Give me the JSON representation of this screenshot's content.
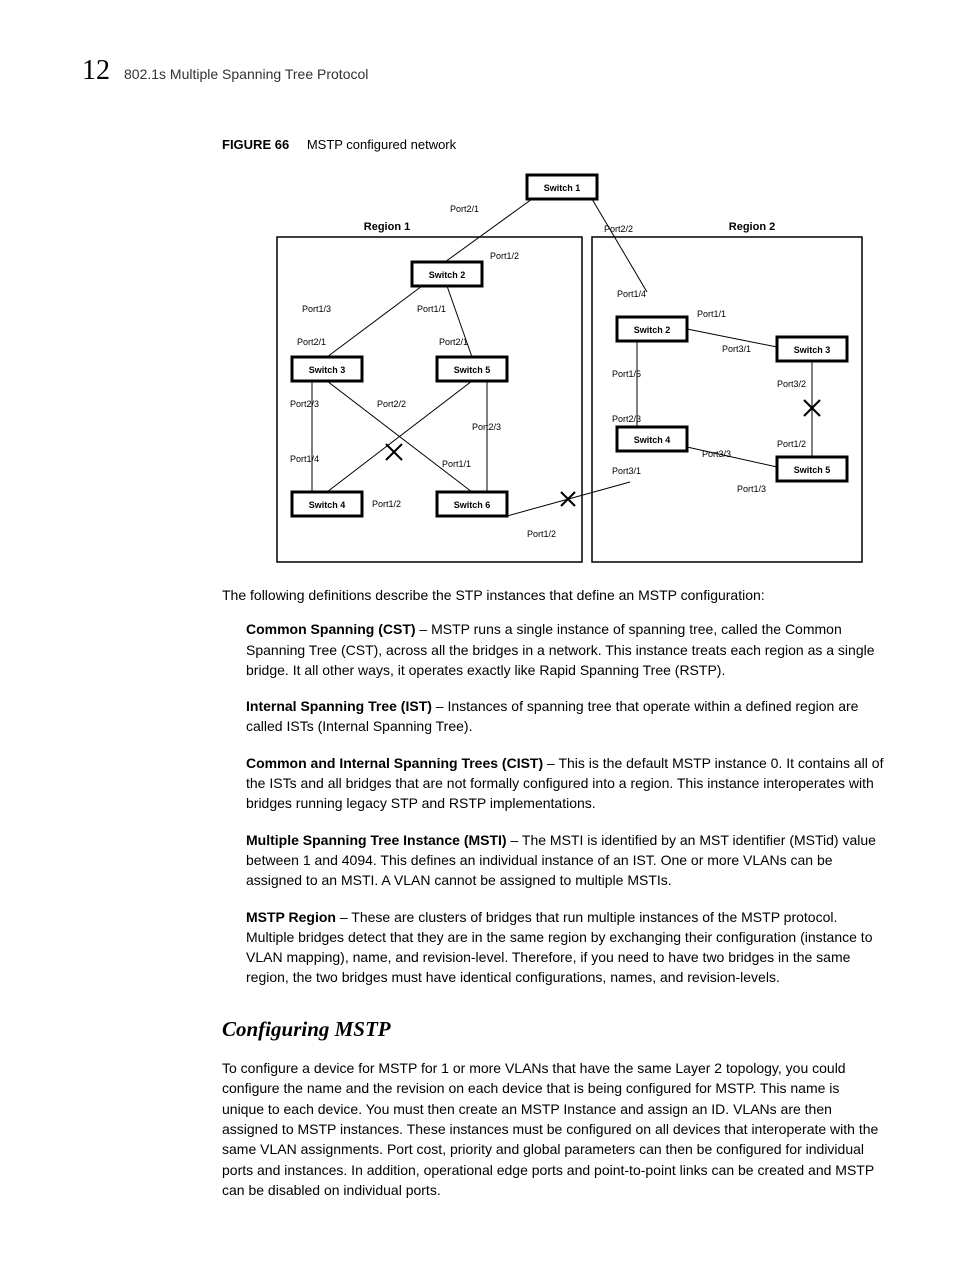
{
  "header": {
    "chapter_number": "12",
    "running_title": "802.1s Multiple Spanning Tree Protocol"
  },
  "figure": {
    "label": "FIGURE 66",
    "caption": "MSTP configured network",
    "diagram": {
      "regions": {
        "r1": "Region 1",
        "r2": "Region 2"
      },
      "switches": {
        "top_s1": "Switch 1",
        "r1_s2": "Switch 2",
        "r1_s3": "Switch 3",
        "r1_s4": "Switch 4",
        "r1_s5": "Switch 5",
        "r1_s6": "Switch 6",
        "r2_s2": "Switch 2",
        "r2_s3": "Switch 3",
        "r2_s4": "Switch 4",
        "r2_s5": "Switch 5"
      },
      "ports": {
        "p21": "Port2/1",
        "p22": "Port2/2",
        "p23": "Port2/3",
        "p11": "Port1/1",
        "p12": "Port1/2",
        "p13": "Port1/3",
        "p14": "Port1/4",
        "p15": "Port1/5",
        "p31": "Port3/1",
        "p32": "Port3/2",
        "p33": "Port3/3"
      }
    }
  },
  "intro": "The following definitions describe the STP instances that define an MSTP configuration:",
  "defs": [
    {
      "term": "Common Spanning (CST)",
      "text": " – MSTP runs a single instance of spanning tree, called the Common Spanning Tree (CST), across all the bridges in a network. This instance treats each region as a single bridge. It all other ways, it operates exactly like Rapid Spanning Tree (RSTP)."
    },
    {
      "term": "Internal Spanning Tree (IST)",
      "text": " – Instances of spanning tree that operate within a defined region are called ISTs (Internal Spanning Tree)."
    },
    {
      "term": "Common and Internal Spanning Trees (CIST)",
      "text": " – This is the default MSTP instance 0. It contains all of the ISTs and all bridges that are not formally configured into a region. This instance interoperates with bridges running legacy STP and RSTP implementations."
    },
    {
      "term": "Multiple Spanning Tree Instance (MSTI)",
      "text": " – The MSTI is identified by an MST identifier (MSTid) value between 1 and 4094. This defines an individual instance of an IST. One or more VLANs can be assigned to an MSTI. A VLAN cannot be assigned to multiple MSTIs."
    },
    {
      "term": "MSTP Region",
      "text": " – These are clusters of bridges that run multiple instances of the MSTP protocol. Multiple bridges detect that they are in the same region by exchanging their configuration (instance to VLAN mapping), name, and revision-level. Therefore, if you need to have two bridges in the same region, the two bridges must have identical configurations, names, and revision-levels."
    }
  ],
  "section": {
    "heading": "Configuring MSTP",
    "para": "To configure a device for MSTP for 1 or more VLANs that have the same Layer 2 topology, you could configure the name and the revision on each device that is being configured for MSTP. This name is unique to each device. You must then create an MSTP Instance and assign an ID. VLANs are then assigned to MSTP instances. These instances must be configured on all devices that interoperate with the same VLAN assignments. Port cost, priority and global parameters can then be configured for individual ports and instances. In addition, operational edge ports and point-to-point links can be created and MSTP can be disabled on individual ports."
  }
}
